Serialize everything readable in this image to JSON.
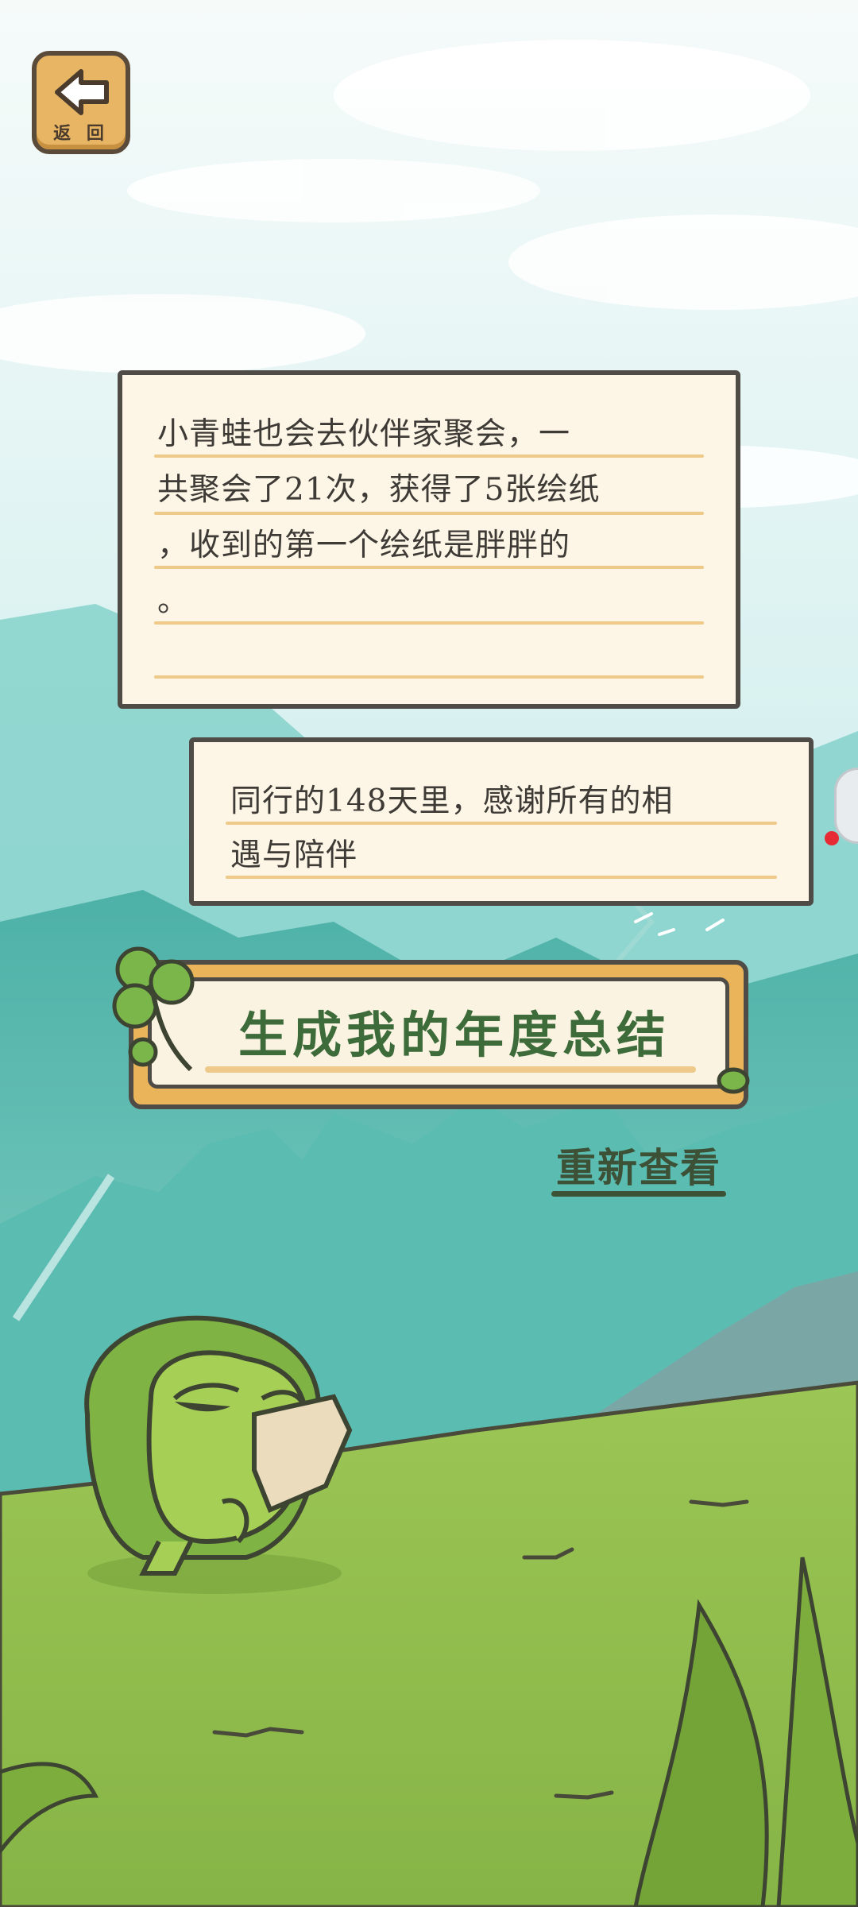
{
  "header": {
    "back_label": "返 回"
  },
  "card_summary": {
    "lines": [
      "小青蛙也会去伙伴家聚会，一",
      "共聚会了21次，获得了5张绘纸",
      "，收到的第一个绘纸是胖胖的",
      "。"
    ]
  },
  "card_thanks": {
    "lines": [
      "同行的148天里，感谢所有的相",
      "遇与陪伴"
    ]
  },
  "actions": {
    "generate_label": "生成我的年度总结",
    "recheck_label": "重新查看"
  },
  "colors": {
    "paper": "#fdf6e6",
    "outline": "#4f4b47",
    "wood": "#e9b45a",
    "title_green": "#3d6b3a",
    "grass": "#8dbb48",
    "mountain": "#5bbfb2",
    "sky": "#def2f1"
  },
  "icons": [
    "back-arrow-icon",
    "clover-icon",
    "frog-character"
  ]
}
